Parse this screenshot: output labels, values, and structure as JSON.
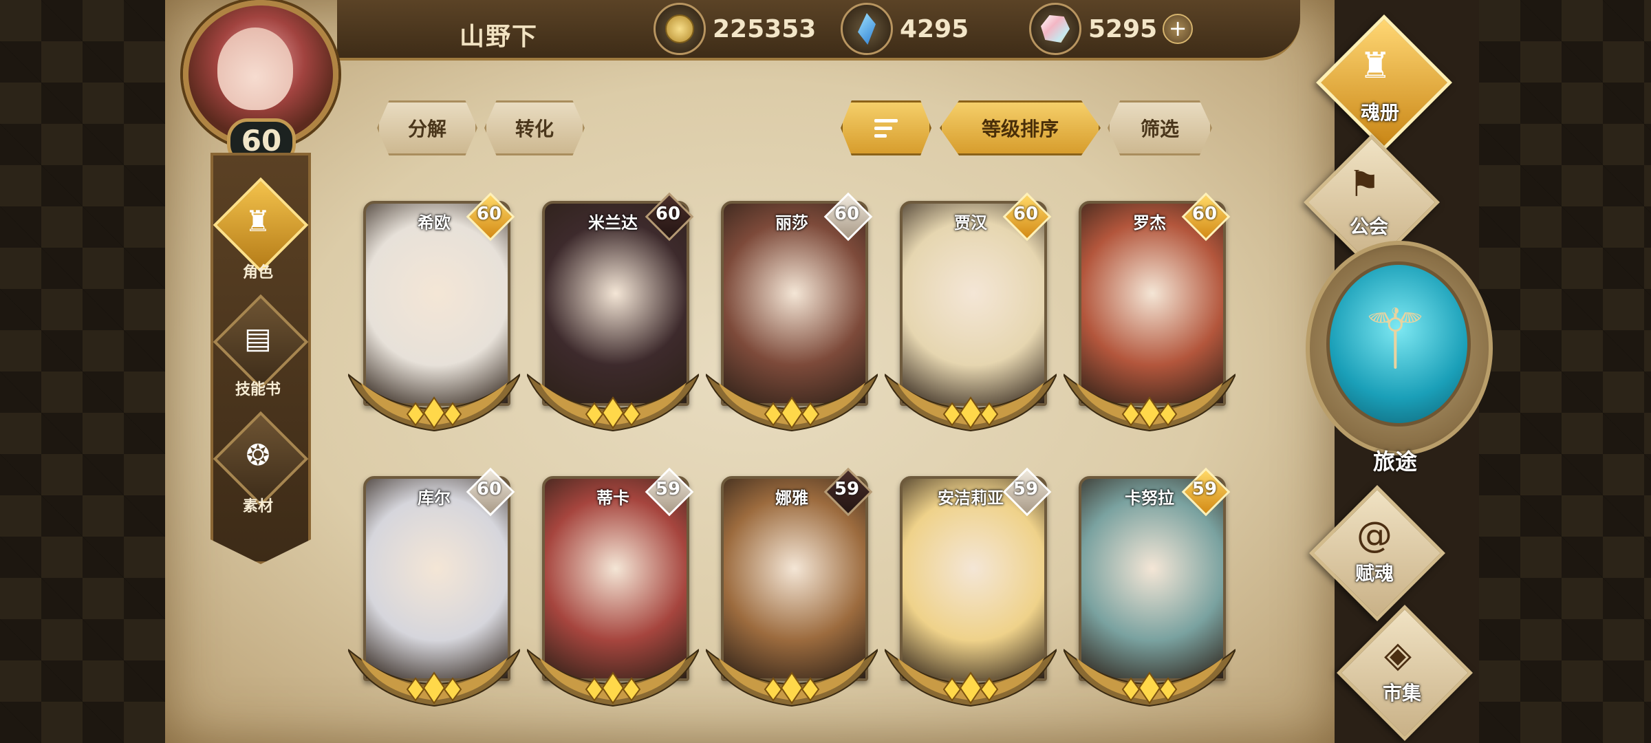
{
  "player": {
    "name": "山野下",
    "level": "60"
  },
  "resources": {
    "gold": "225353",
    "crystal": "4295",
    "gem": "5295",
    "add_label": "+"
  },
  "actions": {
    "decompose": "分解",
    "convert": "转化",
    "sort_by_level": "等级排序",
    "filter": "筛选"
  },
  "categories": [
    {
      "label": "角色",
      "icon": "helmet-icon",
      "active": true
    },
    {
      "label": "技能书",
      "icon": "skillbook-icon",
      "active": false
    },
    {
      "label": "素材",
      "icon": "material-icon",
      "active": false
    }
  ],
  "heroes": [
    {
      "name": "希欧",
      "level": "60",
      "badge": "gold",
      "color": "#e7e1d9"
    },
    {
      "name": "米兰达",
      "level": "60",
      "badge": "dark",
      "color": "#3d2a2c"
    },
    {
      "name": "丽莎",
      "level": "60",
      "badge": "silver",
      "color": "#7d4a3a"
    },
    {
      "name": "贾汉",
      "level": "60",
      "badge": "gold",
      "color": "#e6d6b0"
    },
    {
      "name": "罗杰",
      "level": "60",
      "badge": "gold",
      "color": "#b3563c"
    },
    {
      "name": "库尔",
      "level": "60",
      "badge": "silver",
      "color": "#d6d6dc"
    },
    {
      "name": "蒂卡",
      "level": "59",
      "badge": "silver",
      "color": "#a6453e"
    },
    {
      "name": "娜雅",
      "level": "59",
      "badge": "dark",
      "color": "#9c6b3e"
    },
    {
      "name": "安洁莉亚",
      "level": "59",
      "badge": "silver",
      "color": "#efd28a"
    },
    {
      "name": "卡努拉",
      "level": "59",
      "badge": "gold",
      "color": "#7aa2a0"
    }
  ],
  "right_nav": {
    "soulbook": "魂册",
    "guild": "公会",
    "journey": "旅途",
    "endow": "赋魂",
    "market": "市集"
  },
  "colors": {
    "accent_gold": "#e3a935",
    "parchment": "#dccca8",
    "journey_blue": "#1a9fb8"
  }
}
